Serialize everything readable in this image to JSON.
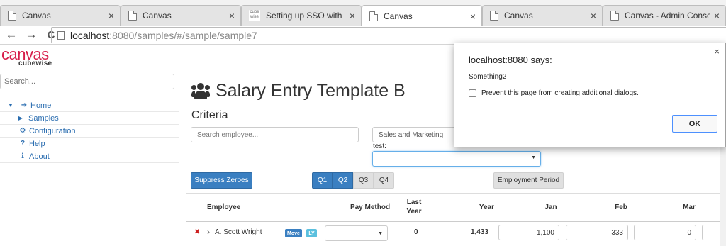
{
  "browser": {
    "tabs": [
      {
        "title": "Canvas",
        "active": false,
        "favicon": "page-icon"
      },
      {
        "title": "Canvas",
        "active": false,
        "favicon": "page-icon"
      },
      {
        "title": "Setting up SSO with CAM",
        "active": false,
        "favicon": "cubewise-icon",
        "favicon_text": "cube wise"
      },
      {
        "title": "Canvas",
        "active": true,
        "favicon": "page-icon"
      },
      {
        "title": "Canvas",
        "active": false,
        "favicon": "page-icon"
      },
      {
        "title": "Canvas - Admin Console",
        "active": false,
        "favicon": "page-icon"
      }
    ],
    "close_glyph": "×",
    "back_glyph": "←",
    "forward_glyph": "→",
    "reload_glyph": "C",
    "url_host": "localhost",
    "url_path": ":8080/samples/#/sample/sample7"
  },
  "app": {
    "logo_main": "canvas",
    "logo_sub": "cubewise",
    "sidebar": {
      "search_placeholder": "Search...",
      "items": [
        {
          "label": "Home",
          "icon": "sign-in-icon",
          "caret": "▼"
        },
        {
          "label": "Samples",
          "icon": "",
          "caret": "▶"
        },
        {
          "label": "Configuration",
          "icon": "gears-icon",
          "caret": ""
        },
        {
          "label": "Help",
          "icon": "question-icon",
          "caret": ""
        },
        {
          "label": "About",
          "icon": "info-icon",
          "caret": ""
        }
      ]
    },
    "page_title": "Salary Entry Template B",
    "criteria_label": "Criteria",
    "search_employee_placeholder": "Search employee...",
    "department_value": "Sales and Marketing",
    "test_label": "test:",
    "buttons": {
      "suppress_zeroes": "Suppress Zeroes",
      "quarters": [
        {
          "label": "Q1",
          "selected": true
        },
        {
          "label": "Q2",
          "selected": true
        },
        {
          "label": "Q3",
          "selected": false
        },
        {
          "label": "Q4",
          "selected": false
        }
      ],
      "employment_period": "Employment Period"
    },
    "table": {
      "headers": {
        "employee": "Employee",
        "pay_method": "Pay Method",
        "last_year_1": "Last",
        "last_year_2": "Year",
        "year": "Year",
        "jan": "Jan",
        "feb": "Feb",
        "mar": "Mar"
      },
      "rows": [
        {
          "delete_glyph": "✖",
          "expand_glyph": "›",
          "employee": "A. Scott Wright",
          "badge_move": "Move",
          "badge_ly": "LY",
          "last_year": "0",
          "year": "1,433",
          "jan": "1,100",
          "feb": "333",
          "mar": "0"
        }
      ]
    }
  },
  "dialog": {
    "origin": "localhost:8080 says:",
    "message": "Something2",
    "checkbox_label": "Prevent this page from creating additional dialogs.",
    "ok_label": "OK",
    "close_glyph": "×"
  },
  "colors": {
    "brand": "#d71f4b",
    "primary": "#3a7fc1",
    "link": "#2a6db0",
    "delete": "#cc1f1f",
    "badge_move": "#3a7fc1",
    "badge_ly": "#5bc0de"
  }
}
